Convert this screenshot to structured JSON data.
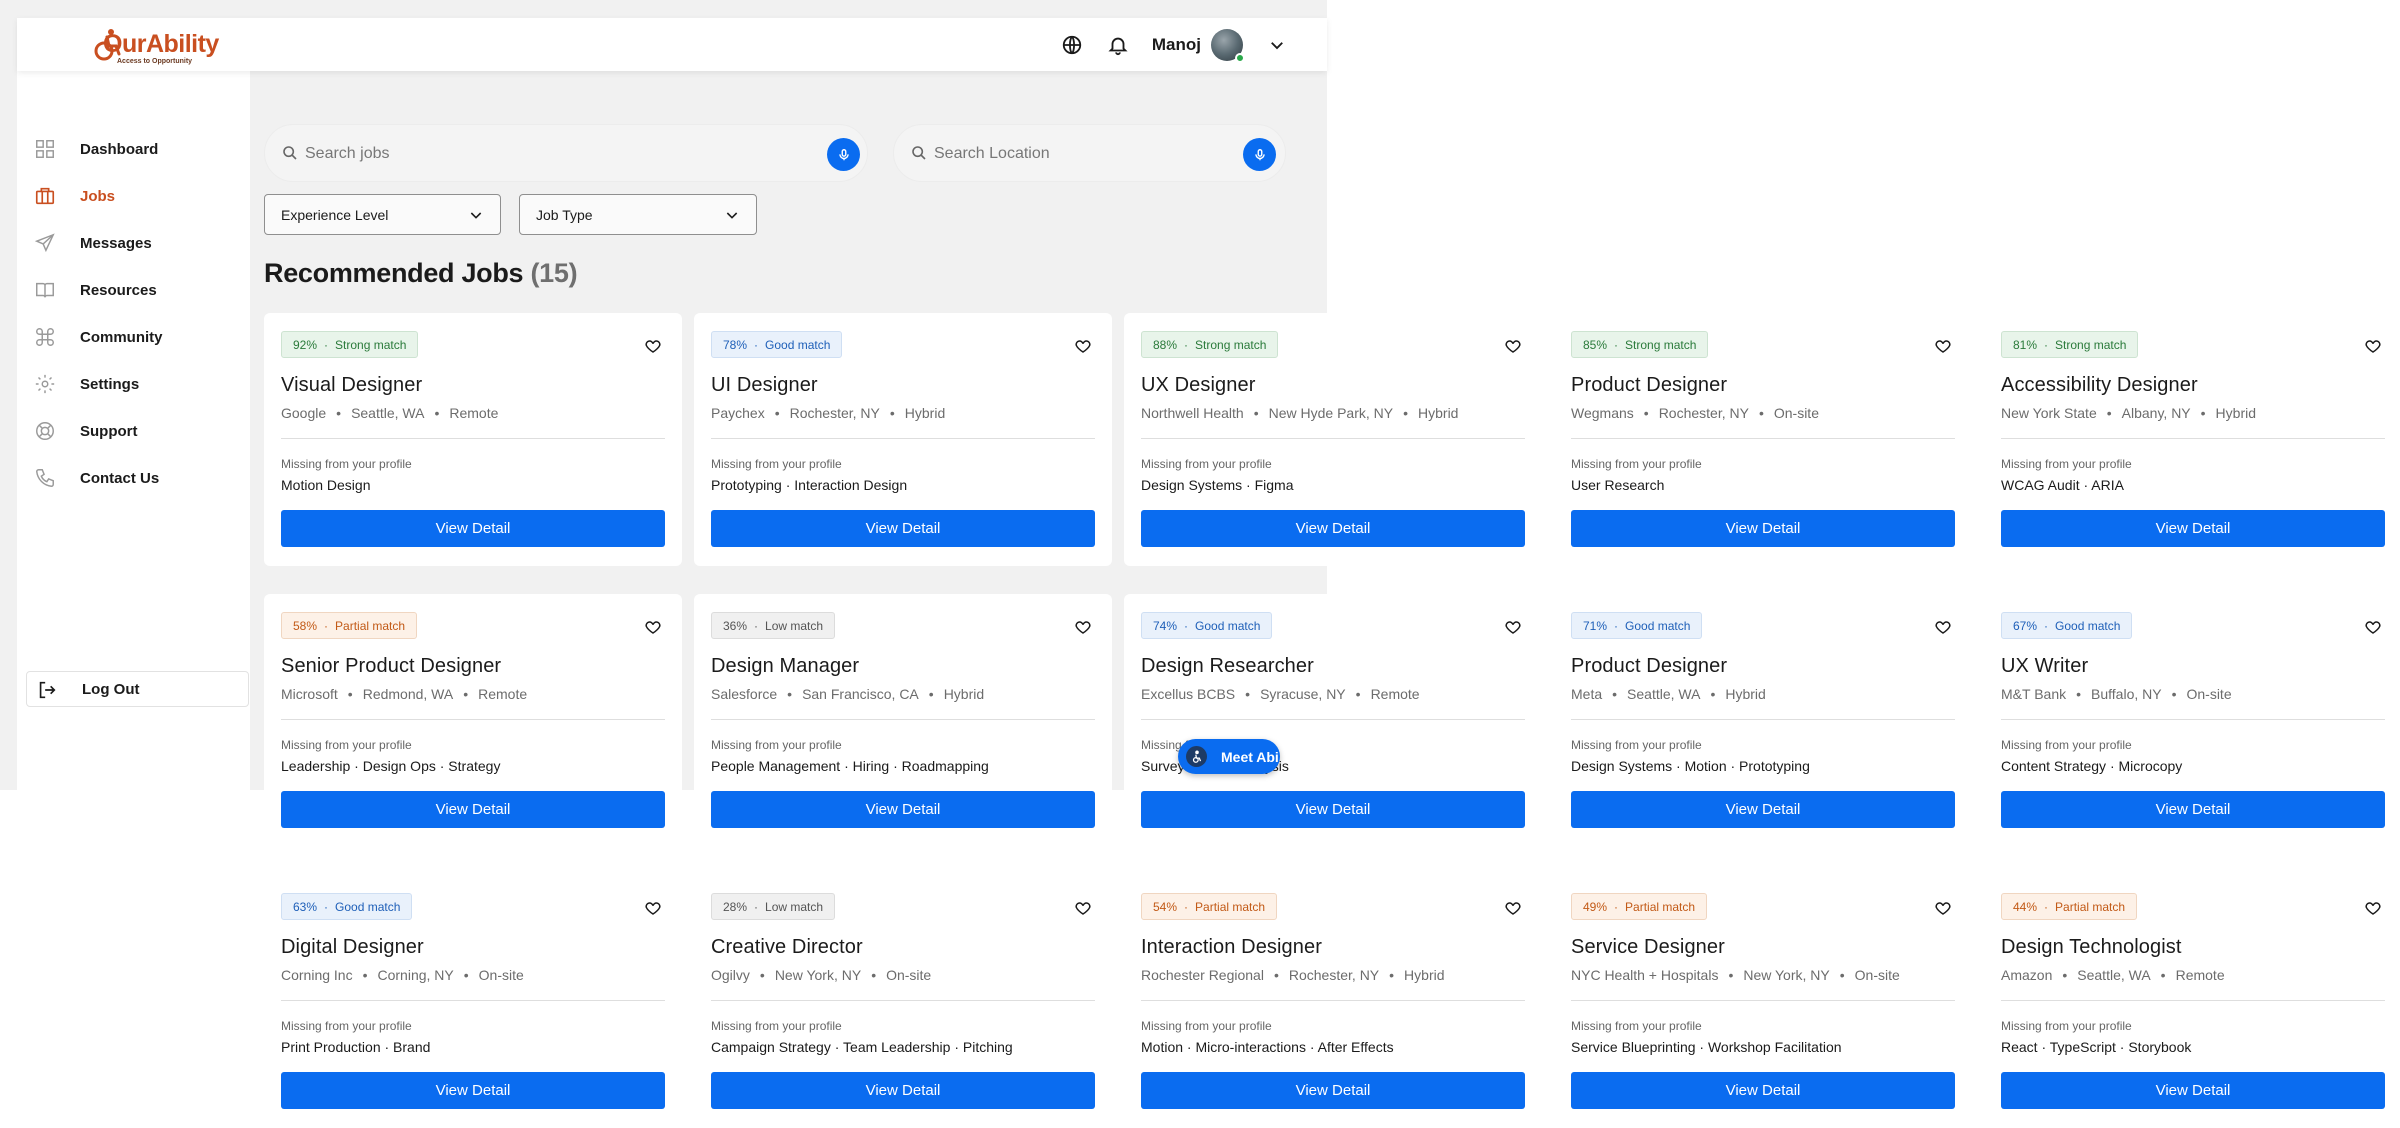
{
  "brand": {
    "name": "OurAbility",
    "tagline": "Access to Opportunity",
    "accent": "#c94f20",
    "primary": "#0a6cf0"
  },
  "header": {
    "user_name": "Manoj",
    "icons": [
      "globe-icon",
      "bell-icon",
      "chevron-down-icon"
    ]
  },
  "sidebar": {
    "items": [
      {
        "label": "Dashboard",
        "icon": "grid-icon",
        "active": false
      },
      {
        "label": "Jobs",
        "icon": "briefcase-icon",
        "active": true
      },
      {
        "label": "Messages",
        "icon": "send-icon",
        "active": false
      },
      {
        "label": "Resources",
        "icon": "book-icon",
        "active": false
      },
      {
        "label": "Community",
        "icon": "command-icon",
        "active": false
      },
      {
        "label": "Settings",
        "icon": "gear-icon",
        "active": false
      },
      {
        "label": "Support",
        "icon": "lifebuoy-icon",
        "active": false
      },
      {
        "label": "Contact Us",
        "icon": "phone-icon",
        "active": false
      }
    ],
    "logout_label": "Log Out"
  },
  "search": {
    "jobs_placeholder": "Search jobs",
    "location_placeholder": "Search Location"
  },
  "filters": {
    "experience_label": "Experience Level",
    "job_type_label": "Job Type"
  },
  "section": {
    "title": "Recommended Jobs",
    "count": "(15)"
  },
  "card_common": {
    "missing_label": "Missing from your profile",
    "view_label": "View Detail"
  },
  "jobs": [
    {
      "match": "92%",
      "match_label": "Strong match",
      "level": "strong",
      "title": "Visual Designer",
      "company": "Google",
      "location": "Seattle, WA",
      "type": "Remote",
      "missing": "Motion Design"
    },
    {
      "match": "78%",
      "match_label": "Good match",
      "level": "good",
      "title": "UI Designer",
      "company": "Paychex",
      "location": "Rochester, NY",
      "type": "Hybrid",
      "missing": "Prototyping · Interaction Design"
    },
    {
      "match": "88%",
      "match_label": "Strong match",
      "level": "strong",
      "title": "UX Designer",
      "company": "Northwell Health",
      "location": "New Hyde Park, NY",
      "type": "Hybrid",
      "missing": "Design Systems · Figma"
    },
    {
      "match": "85%",
      "match_label": "Strong match",
      "level": "strong",
      "title": "Product Designer",
      "company": "Wegmans",
      "location": "Rochester, NY",
      "type": "On-site",
      "missing": "User Research"
    },
    {
      "match": "81%",
      "match_label": "Strong match",
      "level": "strong",
      "title": "Accessibility Designer",
      "company": "New York State",
      "location": "Albany, NY",
      "type": "Hybrid",
      "missing": "WCAG Audit · ARIA"
    },
    {
      "match": "58%",
      "match_label": "Partial match",
      "level": "partial",
      "title": "Senior Product Designer",
      "company": "Microsoft",
      "location": "Redmond, WA",
      "type": "Remote",
      "missing": "Leadership · Design Ops · Strategy"
    },
    {
      "match": "36%",
      "match_label": "Low match",
      "level": "low",
      "title": "Design Manager",
      "company": "Salesforce",
      "location": "San Francisco, CA",
      "type": "Hybrid",
      "missing": "People Management · Hiring · Roadmapping"
    },
    {
      "match": "74%",
      "match_label": "Good match",
      "level": "good",
      "title": "Design Researcher",
      "company": "Excellus BCBS",
      "location": "Syracuse, NY",
      "type": "Remote",
      "missing": "Surveys · Data Analysis"
    },
    {
      "match": "71%",
      "match_label": "Good match",
      "level": "good",
      "title": "Product Designer",
      "company": "Meta",
      "location": "Seattle, WA",
      "type": "Hybrid",
      "missing": "Design Systems · Motion · Prototyping"
    },
    {
      "match": "67%",
      "match_label": "Good match",
      "level": "good",
      "title": "UX Writer",
      "company": "M&T Bank",
      "location": "Buffalo, NY",
      "type": "On-site",
      "missing": "Content Strategy · Microcopy"
    },
    {
      "match": "63%",
      "match_label": "Good match",
      "level": "good",
      "title": "Digital Designer",
      "company": "Corning Inc",
      "location": "Corning, NY",
      "type": "On-site",
      "missing": "Print Production · Brand"
    },
    {
      "match": "28%",
      "match_label": "Low match",
      "level": "low",
      "title": "Creative Director",
      "company": "Ogilvy",
      "location": "New York, NY",
      "type": "On-site",
      "missing": "Campaign Strategy · Team Leadership · Pitching"
    },
    {
      "match": "54%",
      "match_label": "Partial match",
      "level": "partial",
      "title": "Interaction Designer",
      "company": "Rochester Regional",
      "location": "Rochester, NY",
      "type": "Hybrid",
      "missing": "Motion · Micro-interactions · After Effects"
    },
    {
      "match": "49%",
      "match_label": "Partial match",
      "level": "partial",
      "title": "Service Designer",
      "company": "NYC Health + Hospitals",
      "location": "New York, NY",
      "type": "On-site",
      "missing": "Service Blueprinting · Workshop Facilitation"
    },
    {
      "match": "44%",
      "match_label": "Partial match",
      "level": "partial",
      "title": "Design Technologist",
      "company": "Amazon",
      "location": "Seattle, WA",
      "type": "Remote",
      "missing": "React · TypeScript · Storybook"
    }
  ],
  "assistant": {
    "label": "Meet Abi",
    "icon": "accessibility-icon"
  }
}
